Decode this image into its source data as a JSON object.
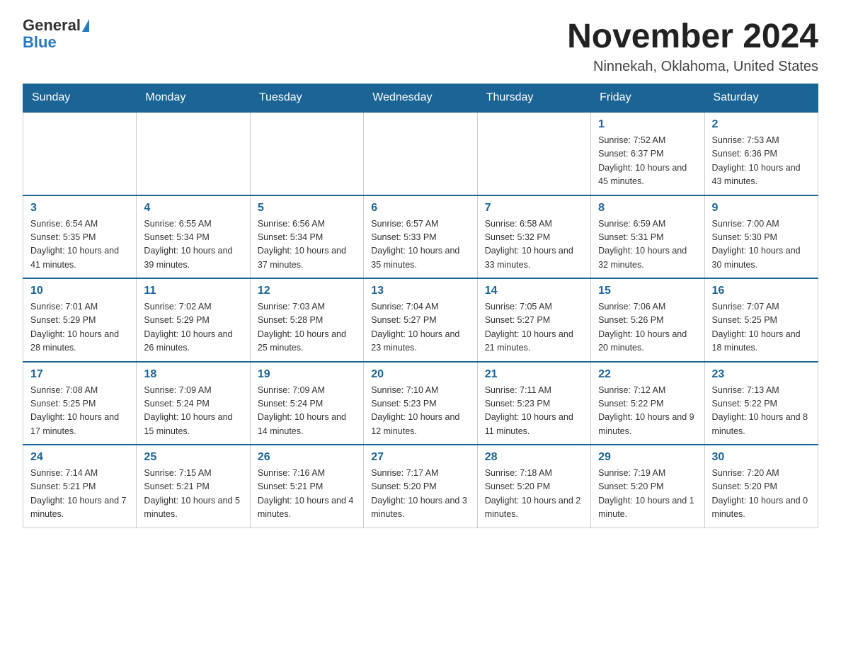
{
  "header": {
    "logo_general": "General",
    "logo_blue": "Blue",
    "month_title": "November 2024",
    "location": "Ninnekah, Oklahoma, United States"
  },
  "days_of_week": [
    "Sunday",
    "Monday",
    "Tuesday",
    "Wednesday",
    "Thursday",
    "Friday",
    "Saturday"
  ],
  "weeks": [
    [
      {
        "day": "",
        "info": ""
      },
      {
        "day": "",
        "info": ""
      },
      {
        "day": "",
        "info": ""
      },
      {
        "day": "",
        "info": ""
      },
      {
        "day": "",
        "info": ""
      },
      {
        "day": "1",
        "info": "Sunrise: 7:52 AM\nSunset: 6:37 PM\nDaylight: 10 hours and 45 minutes."
      },
      {
        "day": "2",
        "info": "Sunrise: 7:53 AM\nSunset: 6:36 PM\nDaylight: 10 hours and 43 minutes."
      }
    ],
    [
      {
        "day": "3",
        "info": "Sunrise: 6:54 AM\nSunset: 5:35 PM\nDaylight: 10 hours and 41 minutes."
      },
      {
        "day": "4",
        "info": "Sunrise: 6:55 AM\nSunset: 5:34 PM\nDaylight: 10 hours and 39 minutes."
      },
      {
        "day": "5",
        "info": "Sunrise: 6:56 AM\nSunset: 5:34 PM\nDaylight: 10 hours and 37 minutes."
      },
      {
        "day": "6",
        "info": "Sunrise: 6:57 AM\nSunset: 5:33 PM\nDaylight: 10 hours and 35 minutes."
      },
      {
        "day": "7",
        "info": "Sunrise: 6:58 AM\nSunset: 5:32 PM\nDaylight: 10 hours and 33 minutes."
      },
      {
        "day": "8",
        "info": "Sunrise: 6:59 AM\nSunset: 5:31 PM\nDaylight: 10 hours and 32 minutes."
      },
      {
        "day": "9",
        "info": "Sunrise: 7:00 AM\nSunset: 5:30 PM\nDaylight: 10 hours and 30 minutes."
      }
    ],
    [
      {
        "day": "10",
        "info": "Sunrise: 7:01 AM\nSunset: 5:29 PM\nDaylight: 10 hours and 28 minutes."
      },
      {
        "day": "11",
        "info": "Sunrise: 7:02 AM\nSunset: 5:29 PM\nDaylight: 10 hours and 26 minutes."
      },
      {
        "day": "12",
        "info": "Sunrise: 7:03 AM\nSunset: 5:28 PM\nDaylight: 10 hours and 25 minutes."
      },
      {
        "day": "13",
        "info": "Sunrise: 7:04 AM\nSunset: 5:27 PM\nDaylight: 10 hours and 23 minutes."
      },
      {
        "day": "14",
        "info": "Sunrise: 7:05 AM\nSunset: 5:27 PM\nDaylight: 10 hours and 21 minutes."
      },
      {
        "day": "15",
        "info": "Sunrise: 7:06 AM\nSunset: 5:26 PM\nDaylight: 10 hours and 20 minutes."
      },
      {
        "day": "16",
        "info": "Sunrise: 7:07 AM\nSunset: 5:25 PM\nDaylight: 10 hours and 18 minutes."
      }
    ],
    [
      {
        "day": "17",
        "info": "Sunrise: 7:08 AM\nSunset: 5:25 PM\nDaylight: 10 hours and 17 minutes."
      },
      {
        "day": "18",
        "info": "Sunrise: 7:09 AM\nSunset: 5:24 PM\nDaylight: 10 hours and 15 minutes."
      },
      {
        "day": "19",
        "info": "Sunrise: 7:09 AM\nSunset: 5:24 PM\nDaylight: 10 hours and 14 minutes."
      },
      {
        "day": "20",
        "info": "Sunrise: 7:10 AM\nSunset: 5:23 PM\nDaylight: 10 hours and 12 minutes."
      },
      {
        "day": "21",
        "info": "Sunrise: 7:11 AM\nSunset: 5:23 PM\nDaylight: 10 hours and 11 minutes."
      },
      {
        "day": "22",
        "info": "Sunrise: 7:12 AM\nSunset: 5:22 PM\nDaylight: 10 hours and 9 minutes."
      },
      {
        "day": "23",
        "info": "Sunrise: 7:13 AM\nSunset: 5:22 PM\nDaylight: 10 hours and 8 minutes."
      }
    ],
    [
      {
        "day": "24",
        "info": "Sunrise: 7:14 AM\nSunset: 5:21 PM\nDaylight: 10 hours and 7 minutes."
      },
      {
        "day": "25",
        "info": "Sunrise: 7:15 AM\nSunset: 5:21 PM\nDaylight: 10 hours and 5 minutes."
      },
      {
        "day": "26",
        "info": "Sunrise: 7:16 AM\nSunset: 5:21 PM\nDaylight: 10 hours and 4 minutes."
      },
      {
        "day": "27",
        "info": "Sunrise: 7:17 AM\nSunset: 5:20 PM\nDaylight: 10 hours and 3 minutes."
      },
      {
        "day": "28",
        "info": "Sunrise: 7:18 AM\nSunset: 5:20 PM\nDaylight: 10 hours and 2 minutes."
      },
      {
        "day": "29",
        "info": "Sunrise: 7:19 AM\nSunset: 5:20 PM\nDaylight: 10 hours and 1 minute."
      },
      {
        "day": "30",
        "info": "Sunrise: 7:20 AM\nSunset: 5:20 PM\nDaylight: 10 hours and 0 minutes."
      }
    ]
  ]
}
